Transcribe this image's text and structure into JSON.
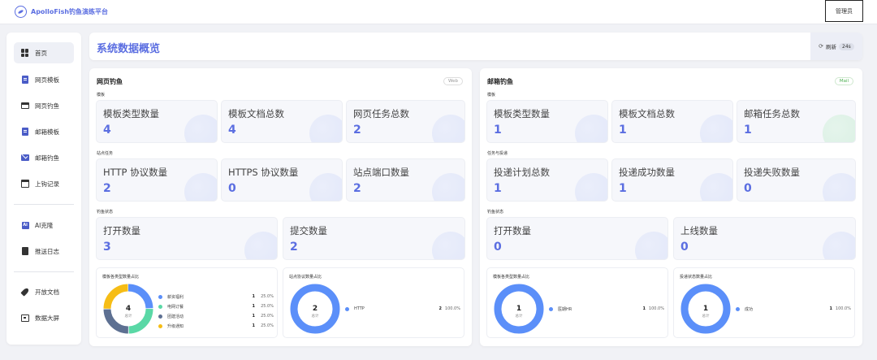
{
  "brand": {
    "name": "ApolloFish钓鱼演练平台"
  },
  "header": {
    "admin_label": "管理员"
  },
  "sidebar": {
    "items": [
      {
        "label": "首页",
        "icon": "grid-icon"
      },
      {
        "label": "网页模板",
        "icon": "document-icon"
      },
      {
        "label": "网页钓鱼",
        "icon": "browser-window-icon"
      },
      {
        "label": "邮箱模板",
        "icon": "document-icon"
      },
      {
        "label": "邮箱钓鱼",
        "icon": "mail-icon"
      },
      {
        "label": "上钩记录",
        "icon": "calendar-icon"
      },
      {
        "label": "AI克隆",
        "icon": "ai-icon"
      },
      {
        "label": "推送日志",
        "icon": "notebook-icon"
      },
      {
        "label": "开放文档",
        "icon": "rocket-icon"
      },
      {
        "label": "数据大屏",
        "icon": "screen-icon"
      }
    ]
  },
  "page": {
    "title": "系统数据概览",
    "refresh_label": "刷新",
    "refresh_count": "24s"
  },
  "web": {
    "title": "网页钓鱼",
    "tag": "Web",
    "sections": {
      "template": "模板",
      "site": "站点任务",
      "status": "钓鱼状态"
    },
    "stats": {
      "template_types": {
        "label": "模板类型数量",
        "value": "4"
      },
      "template_docs": {
        "label": "模板文档总数",
        "value": "4"
      },
      "web_tasks": {
        "label": "网页任务总数",
        "value": "2"
      },
      "http_count": {
        "label": "HTTP 协议数量",
        "value": "2"
      },
      "https_count": {
        "label": "HTTPS 协议数量",
        "value": "0"
      },
      "ports": {
        "label": "站点端口数量",
        "value": "2"
      },
      "opens": {
        "label": "打开数量",
        "value": "3"
      },
      "submits": {
        "label": "提交数量",
        "value": "2"
      }
    },
    "chart1": {
      "title": "模板各类型数量占比",
      "total": "4",
      "total_label": "总计"
    },
    "chart2": {
      "title": "站点协议数量占比",
      "total": "2",
      "total_label": "总计"
    }
  },
  "mail": {
    "title": "邮箱钓鱼",
    "tag": "Mail",
    "sections": {
      "template": "模板",
      "delivery": "任务与投递",
      "status": "钓鱼状态"
    },
    "stats": {
      "template_types": {
        "label": "模板类型数量",
        "value": "1"
      },
      "template_docs": {
        "label": "模板文档总数",
        "value": "1"
      },
      "mail_tasks": {
        "label": "邮箱任务总数",
        "value": "1"
      },
      "plans": {
        "label": "投递计划总数",
        "value": "1"
      },
      "success": {
        "label": "投递成功数量",
        "value": "1"
      },
      "failed": {
        "label": "投递失败数量",
        "value": "0"
      },
      "opens": {
        "label": "打开数量",
        "value": "0"
      },
      "hooked": {
        "label": "上线数量",
        "value": "0"
      }
    },
    "chart1": {
      "title": "模板各类型数量占比",
      "total": "1",
      "total_label": "总计"
    },
    "chart2": {
      "title": "投递状态数量占比",
      "total": "1",
      "total_label": "总计"
    }
  },
  "chart_data": [
    {
      "type": "pie",
      "title": "模板各类型数量占比",
      "categories": [
        "薪资福利",
        "电网订餐",
        "团建活动",
        "升级通知"
      ],
      "values": [
        1,
        1,
        1,
        1
      ],
      "percents": [
        "25.0%",
        "25.0%",
        "25.0%",
        "25.0%"
      ],
      "colors": [
        "#5b8ff9",
        "#5ad8a6",
        "#5d7092",
        "#f6bd16"
      ]
    },
    {
      "type": "pie",
      "title": "站点协议数量占比",
      "categories": [
        "HTTP"
      ],
      "values": [
        2
      ],
      "percents": [
        "100.0%"
      ],
      "colors": [
        "#5b8ff9"
      ]
    },
    {
      "type": "pie",
      "title": "模板各类型数量占比",
      "categories": [
        "医期HR"
      ],
      "values": [
        1
      ],
      "percents": [
        "100.0%"
      ],
      "colors": [
        "#5b8ff9"
      ]
    },
    {
      "type": "pie",
      "title": "投递状态数量占比",
      "categories": [
        "成功"
      ],
      "values": [
        1
      ],
      "percents": [
        "100.0%"
      ],
      "colors": [
        "#5b8ff9"
      ]
    }
  ]
}
